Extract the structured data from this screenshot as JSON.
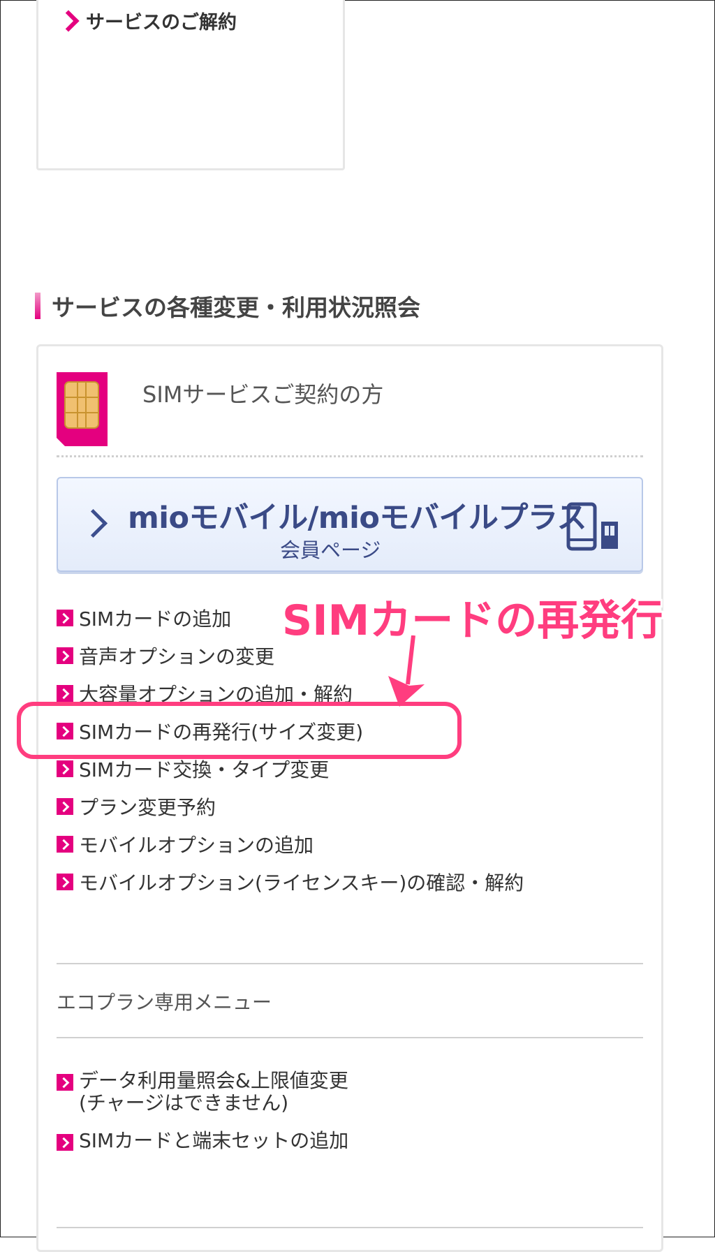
{
  "top_card": {
    "link_label": "サービスのご解約"
  },
  "section": {
    "heading": "サービスの各種変更・利用状況照会"
  },
  "sim_service": {
    "title": "SIMサービスご契約の方",
    "member_button": {
      "title": "mioモバイル/mioモバイルプラス",
      "subtitle": "会員ページ"
    },
    "links": [
      "SIMカードの追加",
      "音声オプションの変更",
      "大容量オプションの追加・解約",
      "SIMカードの再発行(サイズ変更)",
      "SIMカード交換・タイプ変更",
      "プラン変更予約",
      "モバイルオプションの追加",
      "モバイルオプション(ライセンスキー)の確認・解約"
    ]
  },
  "eco_plan": {
    "title": "エコプラン専用メニュー",
    "links": [
      {
        "line1": "データ利用量照会&上限値変更",
        "line2": "(チャージはできません)"
      },
      {
        "line1": "SIMカードと端末セットの追加",
        "line2": ""
      }
    ]
  },
  "annotation": {
    "callout_text": "SIMカードの再発行",
    "color": "#ff3d7f"
  },
  "colors": {
    "accent": "#e4007f",
    "member_button_text": "#3a4a86"
  }
}
